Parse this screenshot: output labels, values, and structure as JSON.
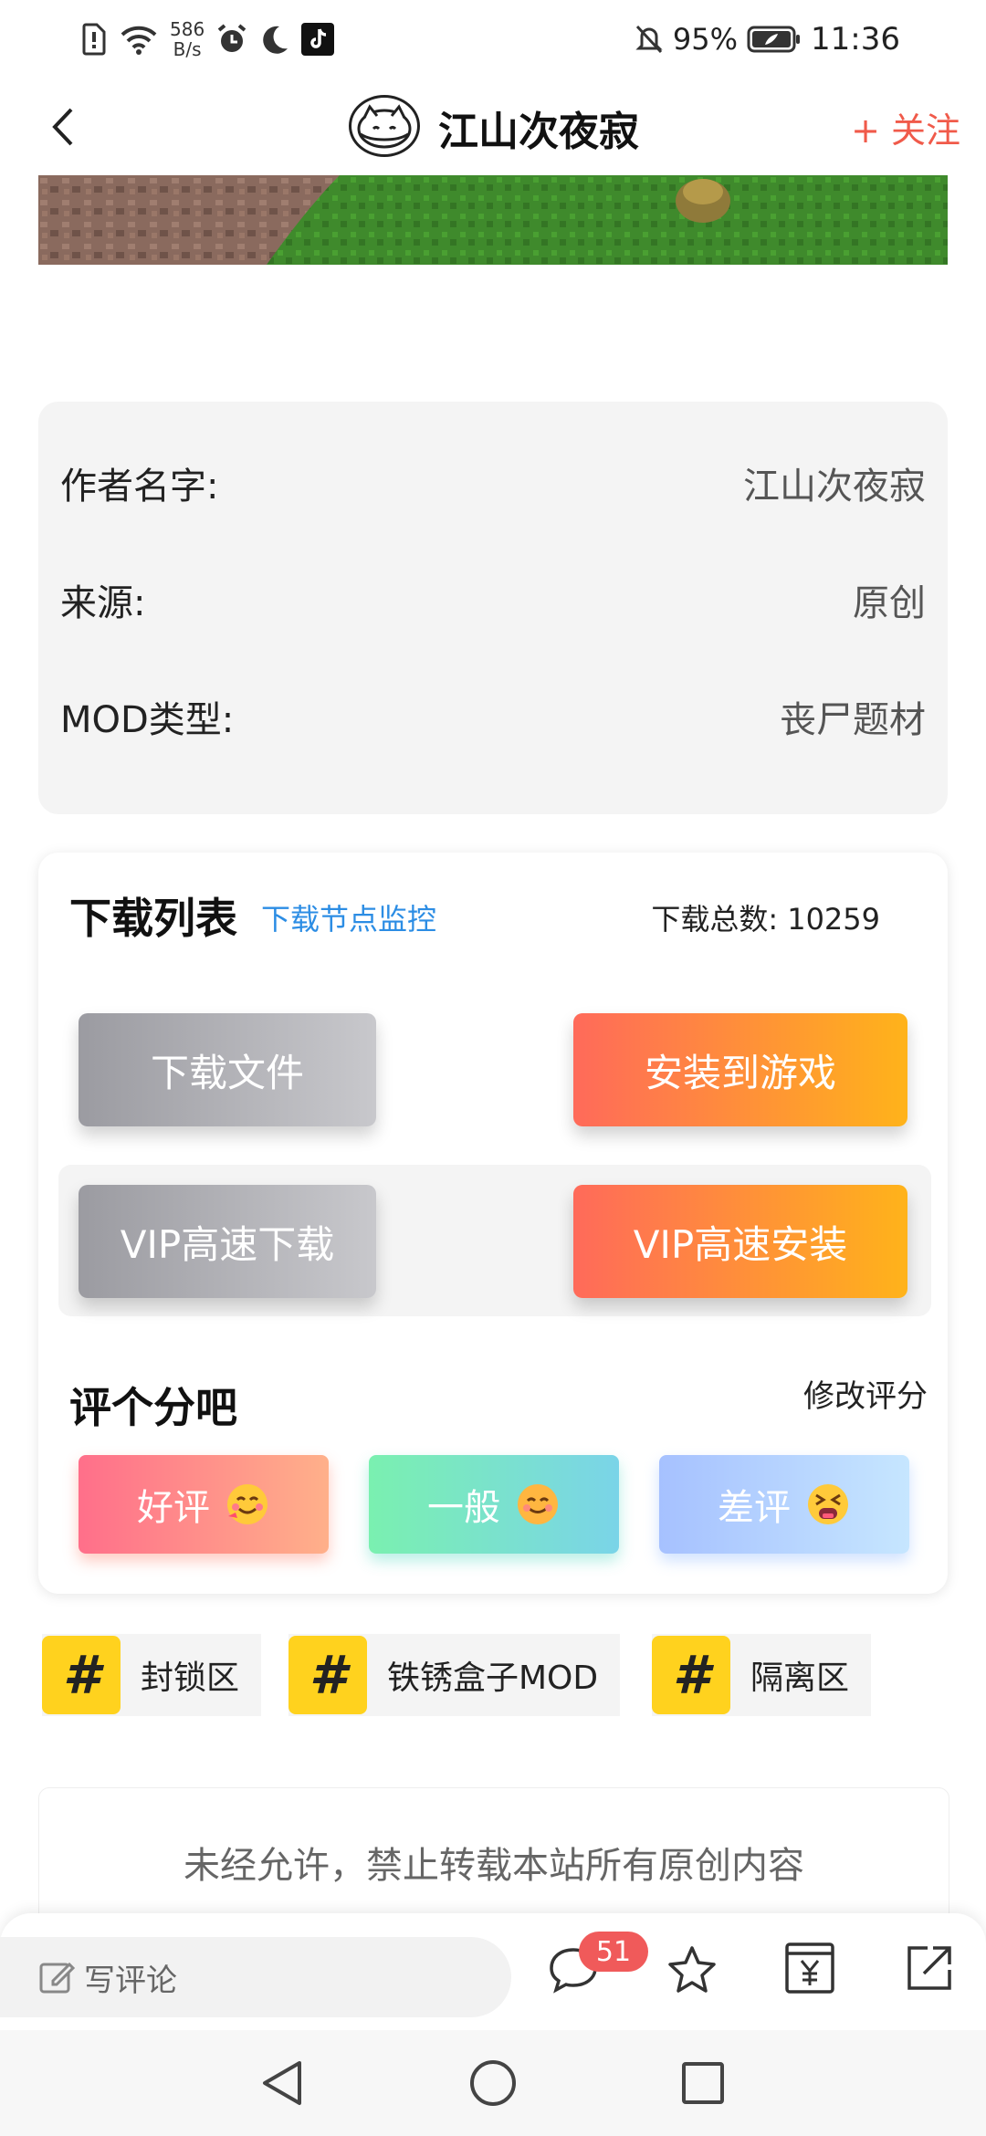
{
  "status_bar": {
    "net_speed_value": "586",
    "net_speed_unit": "B/s",
    "battery": "95%",
    "time": "11:36"
  },
  "header": {
    "title": "江山次夜寂",
    "follow_label": "+ 关注"
  },
  "info": {
    "rows": [
      {
        "label": "作者名字:",
        "value": "江山次夜寂"
      },
      {
        "label": "来源:",
        "value": "原创"
      },
      {
        "label": "MOD类型:",
        "value": "丧尸题材"
      }
    ]
  },
  "download": {
    "title": "下载列表",
    "monitor_link": "下载节点监控",
    "total_label": "下载总数:",
    "total_value": "10259",
    "download_file": "下载文件",
    "install_game": "安装到游戏",
    "vip_download": "VIP高速下载",
    "vip_install": "VIP高速安装"
  },
  "rating": {
    "title": "评个分吧",
    "edit": "修改评分",
    "good": "好评",
    "normal": "一般",
    "bad": "差评"
  },
  "tags": [
    {
      "hash": "#",
      "label": "封锁区"
    },
    {
      "hash": "#",
      "label": "铁锈盒子MOD"
    },
    {
      "hash": "#",
      "label": "隔离区"
    }
  ],
  "notice": {
    "text": "未经允许，禁止转载本站所有原创内容"
  },
  "bottom_bar": {
    "comment_placeholder": "写评论",
    "comment_count": "51"
  },
  "colors": {
    "accent": "#f05a4a",
    "link": "#2c8de4",
    "tag_yellow": "#ffd21e"
  }
}
